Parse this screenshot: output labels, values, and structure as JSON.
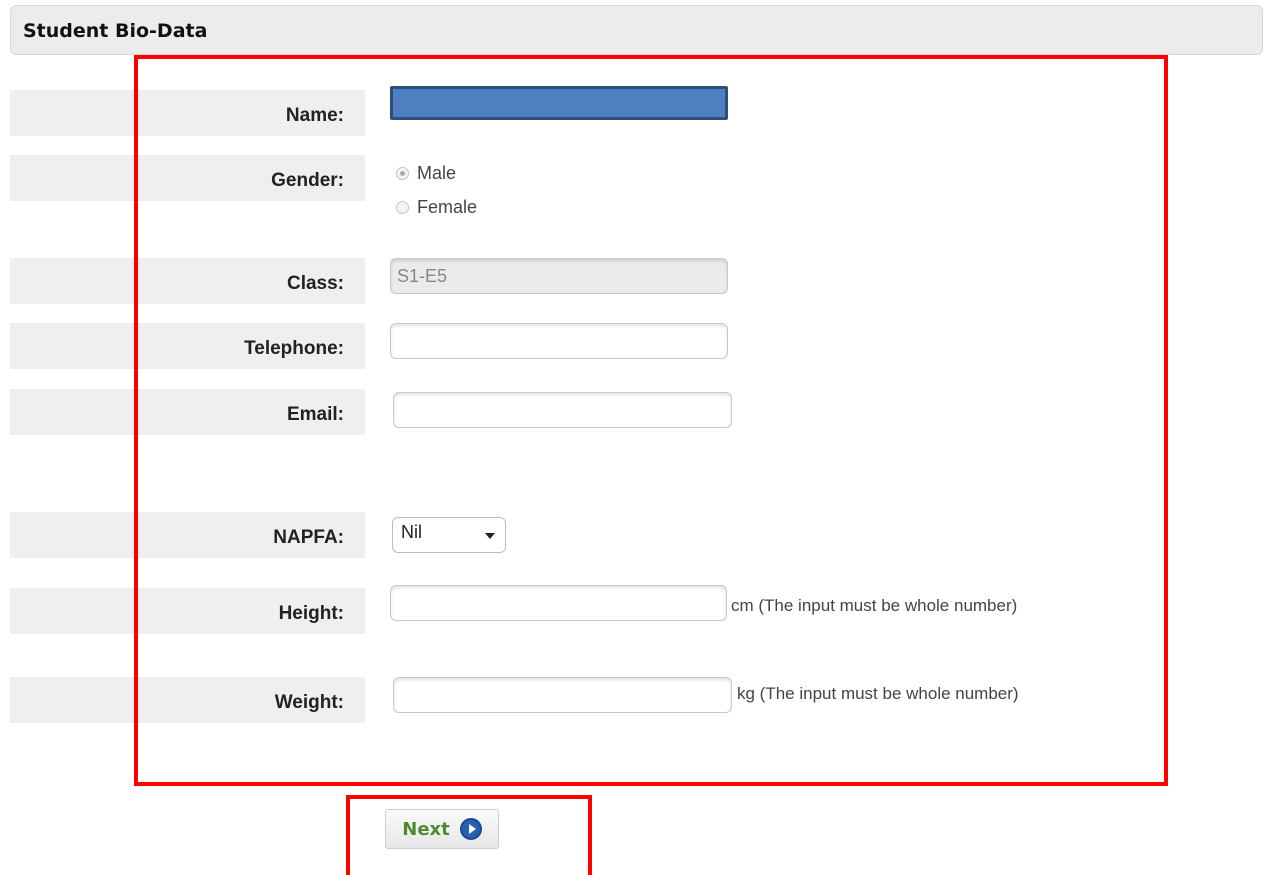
{
  "header": {
    "title": "Student Bio-Data"
  },
  "form": {
    "name": {
      "label": "Name:",
      "value": ""
    },
    "gender": {
      "label": "Gender:",
      "options": [
        "Male",
        "Female"
      ],
      "selected": "Male"
    },
    "class": {
      "label": "Class:",
      "value": "S1-E5"
    },
    "telephone": {
      "label": "Telephone:",
      "value": ""
    },
    "email": {
      "label": "Email:",
      "value": ""
    },
    "napfa": {
      "label": "NAPFA:",
      "selected": "Nil"
    },
    "height": {
      "label": "Height:",
      "value": "",
      "hint": "cm (The input must be whole number)"
    },
    "weight": {
      "label": "Weight:",
      "value": "",
      "hint": "kg (The input must be whole number)"
    }
  },
  "actions": {
    "next_label": "Next"
  },
  "colors": {
    "highlight_border": "#ff0000",
    "next_text": "#4e8a2e",
    "next_icon": "#2a5fb0",
    "name_fill": "#4f7fc0"
  },
  "icons": {
    "next": "play-circle-icon",
    "select_caret": "caret-down-icon"
  }
}
